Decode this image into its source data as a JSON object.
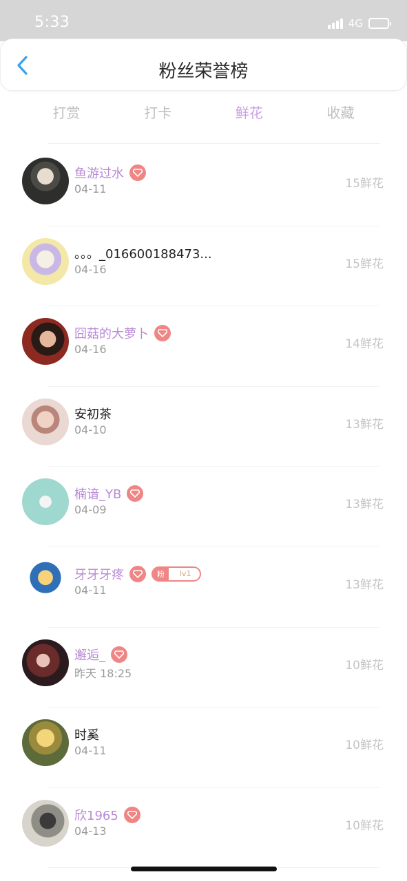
{
  "status_bar": {
    "time": "5:33",
    "network": "4G"
  },
  "header": {
    "title": "粉丝荣誉榜"
  },
  "tabs": [
    {
      "label": "打赏",
      "active": false
    },
    {
      "label": "打卡",
      "active": false
    },
    {
      "label": "鲜花",
      "active": true
    },
    {
      "label": "收藏",
      "active": false
    }
  ],
  "rank_list": [
    {
      "name": "鱼游过水",
      "date": "04-11",
      "count": "15鲜花",
      "vip": true,
      "fan_badge": false
    },
    {
      "name": "。。。_016600188473...",
      "date": "04-16",
      "count": "15鲜花",
      "vip": false,
      "fan_badge": false
    },
    {
      "name": "囧菇的大萝卜",
      "date": "04-16",
      "count": "14鲜花",
      "vip": true,
      "fan_badge": false
    },
    {
      "name": "安初茶",
      "date": "04-10",
      "count": "13鲜花",
      "vip": false,
      "fan_badge": false
    },
    {
      "name": "楠谙_YB",
      "date": "04-09",
      "count": "13鲜花",
      "vip": true,
      "fan_badge": false
    },
    {
      "name": "牙牙牙疼",
      "date": "04-11",
      "count": "13鲜花",
      "vip": true,
      "fan_badge": true,
      "fan_label": "粉",
      "fan_level": "lv1"
    },
    {
      "name": "邂逅_",
      "date": "昨天 18:25",
      "count": "10鲜花",
      "vip": true,
      "fan_badge": false
    },
    {
      "name": "时奚",
      "date": "04-11",
      "count": "10鲜花",
      "vip": false,
      "fan_badge": false
    },
    {
      "name": "欣1965",
      "date": "04-13",
      "count": "10鲜花",
      "vip": true,
      "fan_badge": false
    }
  ],
  "colors": {
    "accent": "#c9a0e0",
    "vip_name": "#b98ad6",
    "badge": "#f08585",
    "back_arrow": "#3aa0e8"
  }
}
